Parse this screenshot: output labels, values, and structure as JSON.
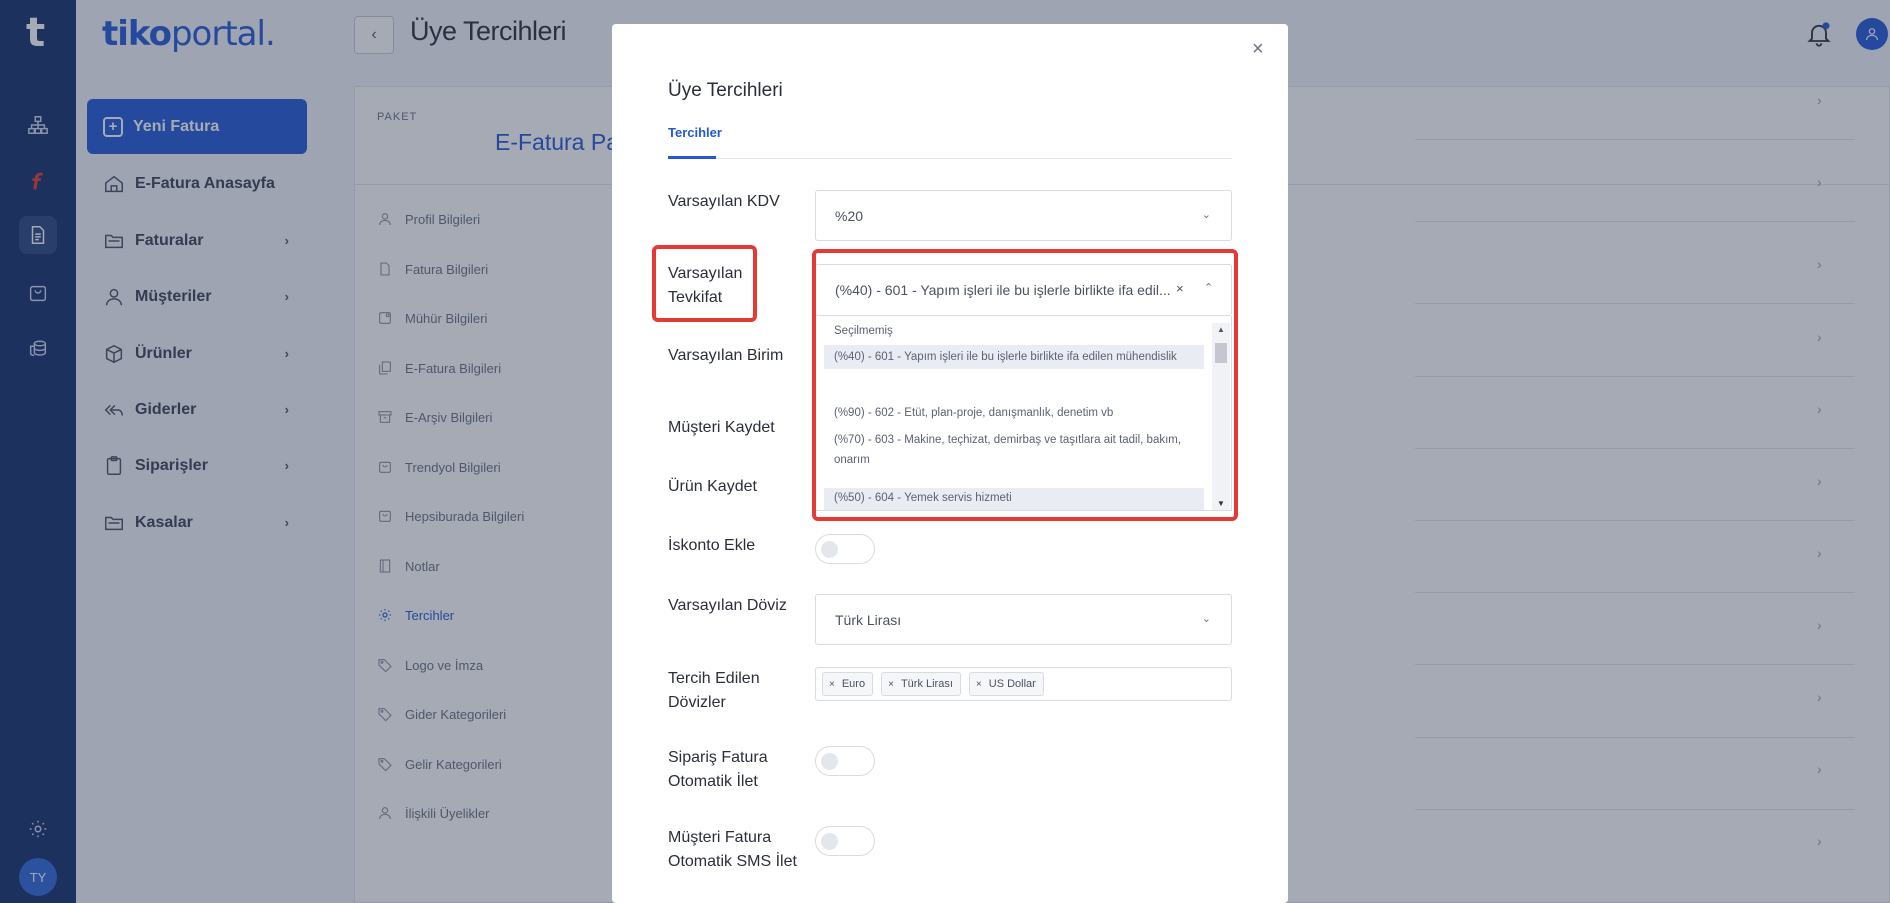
{
  "rail": {
    "logo": "t",
    "avatar": "TY"
  },
  "sidebar": {
    "brand": {
      "part1": "tiko",
      "part2": "portal",
      "part3": "."
    },
    "new_invoice": "Yeni Fatura",
    "items": [
      {
        "label": "E-Fatura Anasayfa",
        "icon": "home-icon",
        "has_chevron": false
      },
      {
        "label": "Faturalar",
        "icon": "folder-icon",
        "has_chevron": true
      },
      {
        "label": "Müşteriler",
        "icon": "user-icon",
        "has_chevron": true
      },
      {
        "label": "Ürünler",
        "icon": "box-icon",
        "has_chevron": true
      },
      {
        "label": "Giderler",
        "icon": "reply-all-icon",
        "has_chevron": true
      },
      {
        "label": "Siparişler",
        "icon": "clipboard-icon",
        "has_chevron": true
      },
      {
        "label": "Kasalar",
        "icon": "folder-icon",
        "has_chevron": true
      }
    ]
  },
  "header": {
    "title": "Üye Tercihleri",
    "back": "‹"
  },
  "card": {
    "package_label": "PAKET",
    "package_name": "E-Fatura Pa",
    "menu": [
      {
        "label": "Profil Bilgileri",
        "icon": "user-icon"
      },
      {
        "label": "Fatura Bilgileri",
        "icon": "document-icon"
      },
      {
        "label": "Mühür Bilgileri",
        "icon": "stamp-icon"
      },
      {
        "label": "E-Fatura Bilgileri",
        "icon": "copy-icon"
      },
      {
        "label": "E-Arşiv Bilgileri",
        "icon": "archive-icon"
      },
      {
        "label": "Trendyol Bilgileri",
        "icon": "bag-icon"
      },
      {
        "label": "Hepsiburada Bilgileri",
        "icon": "bag-icon"
      },
      {
        "label": "Notlar",
        "icon": "note-icon"
      },
      {
        "label": "Tercihler",
        "icon": "gear-icon",
        "active": true
      },
      {
        "label": "Logo ve İmza",
        "icon": "tag-icon"
      },
      {
        "label": "Gider Kategorileri",
        "icon": "tag-icon"
      },
      {
        "label": "Gelir Kategorileri",
        "icon": "tag-icon"
      },
      {
        "label": "İlişkili Üyelikler",
        "icon": "user-icon"
      }
    ]
  },
  "modal": {
    "close": "×",
    "title": "Üye Tercihleri",
    "tab": "Tercihler",
    "fields": {
      "kdv_label": "Varsayılan KDV",
      "kdv_value": "%20",
      "tevkifat_label": "Varsayılan Tevkifat",
      "tevkifat_value": "(%40) - 601 - Yapım işleri ile bu işlerle birlikte ifa edil...",
      "birim_label": "Varsayılan Birim",
      "musteri_kaydet_label": "Müşteri Kaydet",
      "urun_kaydet_label": "Ürün Kaydet",
      "iskonto_label": "İskonto Ekle",
      "doviz_label": "Varsayılan Döviz",
      "doviz_value": "Türk Lirası",
      "tercih_dovizler_label": "Tercih Edilen Dövizler",
      "tercih_dovizler": [
        "Euro",
        "Türk Lirası",
        "US Dollar"
      ],
      "siparis_label": "Sipariş Fatura Otomatik İlet",
      "sms_label": "Müşteri Fatura Otomatik SMS İlet"
    },
    "dropdown_options": [
      "Seçilmemiş",
      "(%40) - 601 - Yapım işleri ile bu işlerle birlikte ifa edilen mühendislik",
      "(%90) - 602 - Etüt, plan-proje, danışmanlık, denetim vb",
      "(%70) - 603 - Makine, teçhizat, demirbaş ve taşıtlara ait tadil, bakım, onarım",
      "(%50) - 604 - Yemek servis hizmeti"
    ],
    "clear_symbol": "×"
  },
  "colors": {
    "rail_bg": "#16306a",
    "accent": "#2458d6",
    "highlight_red": "#e53935"
  }
}
